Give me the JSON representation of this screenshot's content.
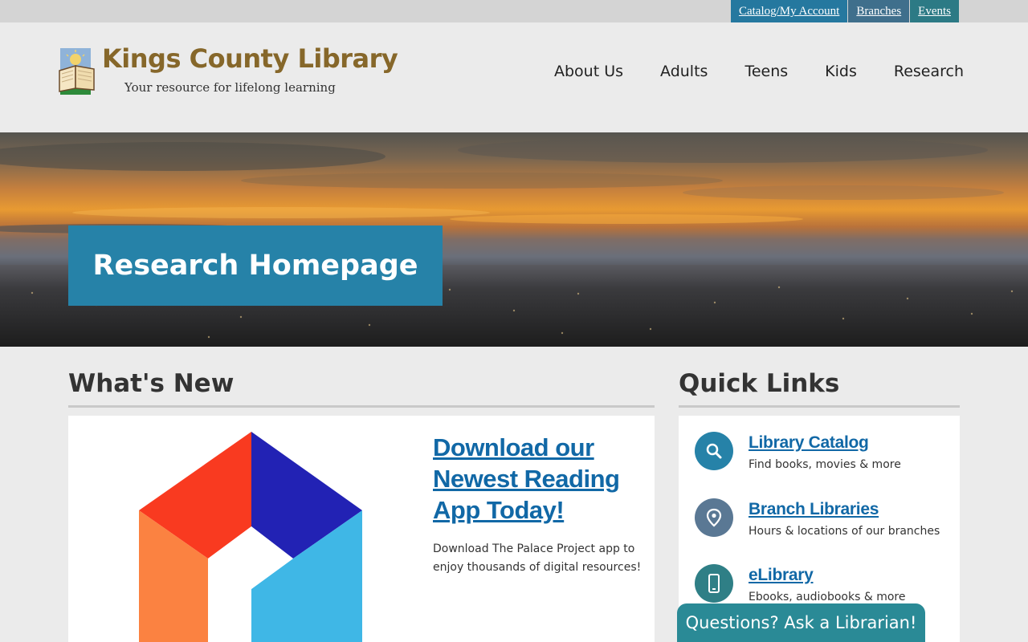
{
  "utility_nav": {
    "catalog": "Catalog/My Account",
    "branches": "Branches",
    "events": "Events"
  },
  "site": {
    "title": "Kings County Library",
    "tagline": "Your resource for lifelong learning"
  },
  "main_nav": [
    "About Us",
    "Adults",
    "Teens",
    "Kids",
    "Research"
  ],
  "hero": {
    "title": "Research Homepage"
  },
  "whats_new": {
    "heading": "What's New",
    "item": {
      "title": "Download our Newest Reading App Today!",
      "description": "Download The Palace Project app to enjoy thousands of digital resources!"
    }
  },
  "quick_links": {
    "heading": "Quick Links",
    "items": [
      {
        "title": "Library Catalog",
        "description": "Find books, movies & more",
        "icon": "search-icon",
        "color": "#2682a8"
      },
      {
        "title": "Branch Libraries",
        "description": "Hours & locations of our branches",
        "icon": "map-pin-icon",
        "color": "#5a7894"
      },
      {
        "title": "eLibrary",
        "description": "Ebooks, audiobooks & more",
        "icon": "mobile-icon",
        "color": "#2f7f86"
      }
    ]
  },
  "chat": {
    "label": "Questions? Ask a Librarian!"
  },
  "colors": {
    "brand_gold": "#86672a",
    "accent_blue": "#2682a8",
    "link_blue": "#1168a6",
    "chat_teal": "#2a8a96"
  }
}
